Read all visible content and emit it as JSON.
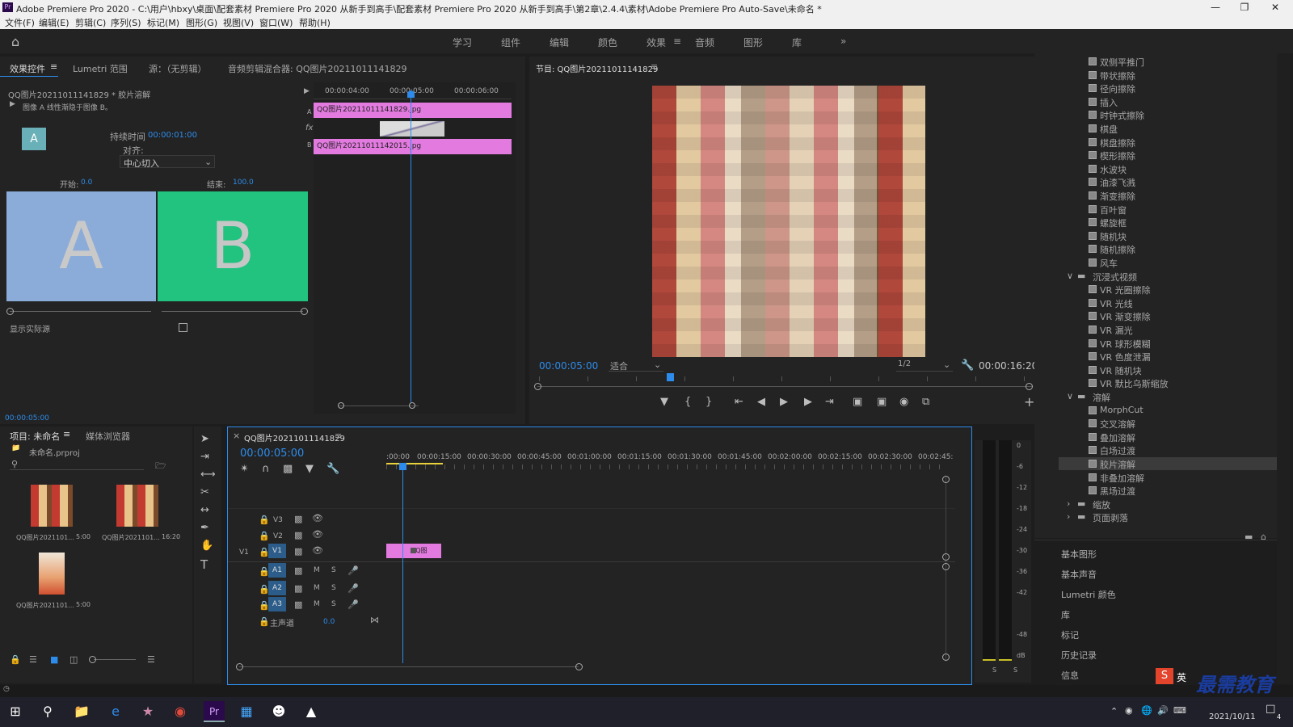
{
  "window": {
    "title": "Adobe Premiere Pro 2020 - C:\\用户\\hbxy\\桌面\\配套素材 Premiere Pro 2020 从新手到高手\\配套素材 Premiere Pro 2020 从新手到高手\\第2章\\2.4.4\\素材\\Adobe Premiere Pro Auto-Save\\未命名 *",
    "app_badge": "Pr"
  },
  "menu": [
    "文件(F)",
    "编辑(E)",
    "剪辑(C)",
    "序列(S)",
    "标记(M)",
    "图形(G)",
    "视图(V)",
    "窗口(W)",
    "帮助(H)"
  ],
  "workspaces": [
    "学习",
    "组件",
    "编辑",
    "颜色",
    "效果",
    "音频",
    "图形",
    "库"
  ],
  "workspace_active": "效果",
  "source_panel": {
    "tabs": [
      "效果控件",
      "Lumetri 范围",
      "源：（无剪辑）",
      "音频剪辑混合器: QQ图片20211011141829"
    ],
    "clip_path": "QQ图片20211011141829 * 胶片溶解",
    "effect_desc": "图像 A 线性渐隐于图像 B。",
    "duration_label": "持续时间",
    "duration_value": "00:00:01:00",
    "align_label": "对齐:",
    "align_value": "中心切入",
    "start_label": "开始:",
    "start_value": "0.0",
    "end_label": "结束:",
    "end_value": "100.0",
    "a_letter": "A",
    "b_letter": "B",
    "show_source_label": "显示实际源",
    "timecode": "00:00:05:00",
    "ruler": [
      "00:00:04:00",
      "00:00:05:00",
      "00:00:06:00"
    ],
    "clip_a": "QQ图片20211011141829.jpg",
    "clip_b": "QQ图片20211011142015.jpg",
    "row_a": "A",
    "row_fx": "fx",
    "row_b": "B"
  },
  "program": {
    "title": "节目: QQ图片20211011141829",
    "timecode": "00:00:05:00",
    "fit": "适合",
    "quality": "1/2",
    "duration": "00:00:16:20"
  },
  "project": {
    "tabs": [
      "项目: 未命名",
      "媒体浏览器"
    ],
    "file": "未命名.prproj",
    "items": [
      {
        "name": "QQ图片2021101...",
        "dur": "5:00"
      },
      {
        "name": "QQ图片2021101...",
        "dur": "16:20"
      },
      {
        "name": "QQ图片2021101...",
        "dur": "5:00"
      }
    ]
  },
  "timeline": {
    "title": "QQ图片20211011141829",
    "timecode": "00:00:05:00",
    "ruler": [
      ":00:00",
      "00:00:15:00",
      "00:00:30:00",
      "00:00:45:00",
      "00:01:00:00",
      "00:01:15:00",
      "00:01:30:00",
      "00:01:45:00",
      "00:02:00:00",
      "00:02:15:00",
      "00:02:30:00",
      "00:02:45:"
    ],
    "tracks": [
      "V3",
      "V2",
      "V1",
      "A1",
      "A2",
      "A3"
    ],
    "source_v1": "V1",
    "master_label": "主声道",
    "master_value": "0.0",
    "clip_label": "QQ图",
    "m": "M",
    "s": "S"
  },
  "meters": [
    "0",
    "-6",
    "-12",
    "-18",
    "-24",
    "-30",
    "-36",
    "-42",
    "-48",
    "dB"
  ],
  "meter_solo": [
    "S",
    "S"
  ],
  "effects": {
    "top_cut": "双侧平推门",
    "wipe_items": [
      "带状擦除",
      "径向擦除",
      "插入",
      "时钟式擦除",
      "棋盘",
      "棋盘擦除",
      "楔形擦除",
      "水波块",
      "油漆飞溅",
      "渐变擦除",
      "百叶窗",
      "螺旋框",
      "随机块",
      "随机擦除",
      "风车"
    ],
    "immersive_folder": "沉浸式视频",
    "immersive_items": [
      "VR 光圈擦除",
      "VR 光线",
      "VR 渐变擦除",
      "VR 漏光",
      "VR 球形模糊",
      "VR 色度泄漏",
      "VR 随机块",
      "VR 默比乌斯缩放"
    ],
    "dissolve_folder": "溶解",
    "dissolve_items": [
      "MorphCut",
      "交叉溶解",
      "叠加溶解",
      "白场过渡",
      "胶片溶解",
      "非叠加溶解",
      "黑场过渡"
    ],
    "dissolve_selected": 4,
    "other_folders": [
      "缩放",
      "页面剥落"
    ]
  },
  "library_panels": [
    "基本图形",
    "基本声音",
    "Lumetri 颜色",
    "库",
    "标记",
    "历史记录",
    "信息"
  ],
  "taskbar": {
    "ime": "英",
    "date": "2021/10/11",
    "watermark": "最需教育",
    "notify_count": "4"
  }
}
